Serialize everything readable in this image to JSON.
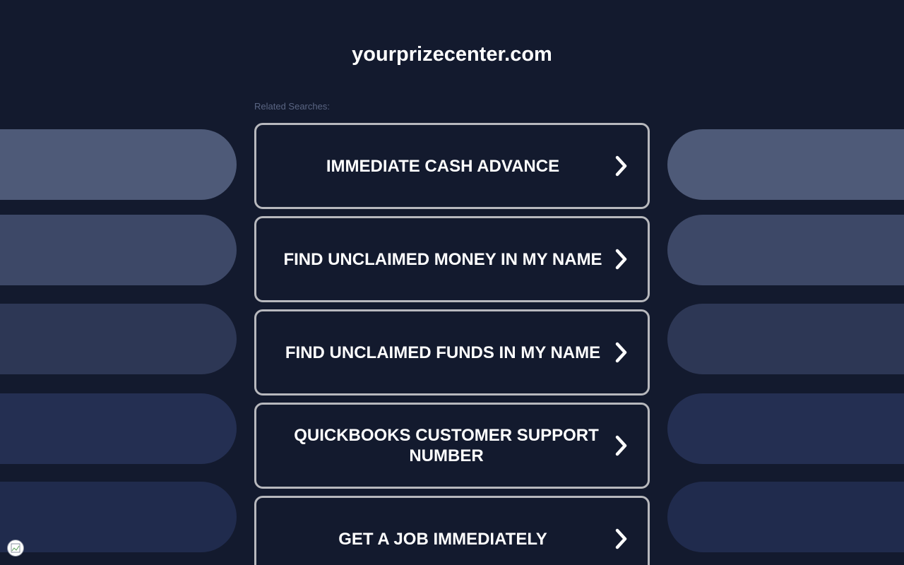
{
  "domain": "yourprizecenter.com",
  "related_label": "Related Searches:",
  "links": [
    {
      "label": "IMMEDIATE CASH ADVANCE"
    },
    {
      "label": "FIND UNCLAIMED MONEY IN MY NAME"
    },
    {
      "label": "FIND UNCLAIMED FUNDS IN MY NAME"
    },
    {
      "label": "QUICKBOOKS CUSTOMER SUPPORT NUMBER"
    },
    {
      "label": "GET A JOB IMMEDIATELY"
    }
  ],
  "colors": {
    "background": "#131a2e",
    "card_border": "#b7b8bd",
    "pills": [
      "#4e5a78",
      "#3d4867",
      "#2d3755",
      "#242f52",
      "#202b4d"
    ]
  },
  "icons": {
    "chevron": "chevron-right-icon",
    "corner": "broken-image-icon"
  }
}
